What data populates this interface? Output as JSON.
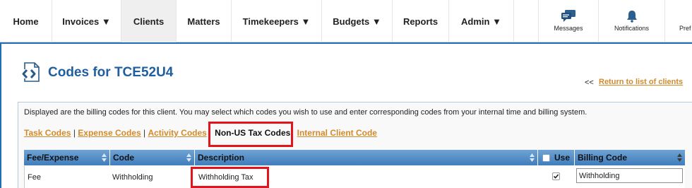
{
  "nav": {
    "items": [
      {
        "label": "Home",
        "active": false
      },
      {
        "label": "Invoices ▼",
        "active": false
      },
      {
        "label": "Clients",
        "active": true
      },
      {
        "label": "Matters",
        "active": false
      },
      {
        "label": "Timekeepers ▼",
        "active": false
      },
      {
        "label": "Budgets ▼",
        "active": false
      },
      {
        "label": "Reports",
        "active": false
      },
      {
        "label": "Admin ▼",
        "active": false
      }
    ],
    "icon_items": [
      {
        "label": "Messages",
        "icon": "chat-bubble-icon"
      },
      {
        "label": "Notifications",
        "icon": "bell-icon"
      },
      {
        "label": "Pref",
        "icon": "preferences-icon"
      }
    ]
  },
  "page": {
    "title": "Codes for TCE52U4",
    "back_arrows": "<<",
    "back_link": "Return to list of clients",
    "intro": "Displayed are the billing codes for this client. You may select which codes you wish to use and enter corresponding codes from your internal time and billing system."
  },
  "tabs": {
    "task": "Task Codes",
    "expense": "Expense Codes",
    "activity": "Activity Codes",
    "non_us_tax": "Non-US Tax Codes",
    "internal_client": "Internal Client Code",
    "separator": "|"
  },
  "table": {
    "headers": {
      "fee_expense": "Fee/Expense",
      "code": "Code",
      "description": "Description",
      "use": "Use",
      "billing_code": "Billing Code"
    },
    "rows": [
      {
        "fee_expense": "Fee",
        "code": "Withholding",
        "description": "Withholding Tax",
        "use": true,
        "billing_code": "Withholding"
      }
    ]
  },
  "colors": {
    "accent_blue": "#1f6fb2",
    "link_orange": "#d38a2c",
    "highlight_red": "#e3141b"
  }
}
